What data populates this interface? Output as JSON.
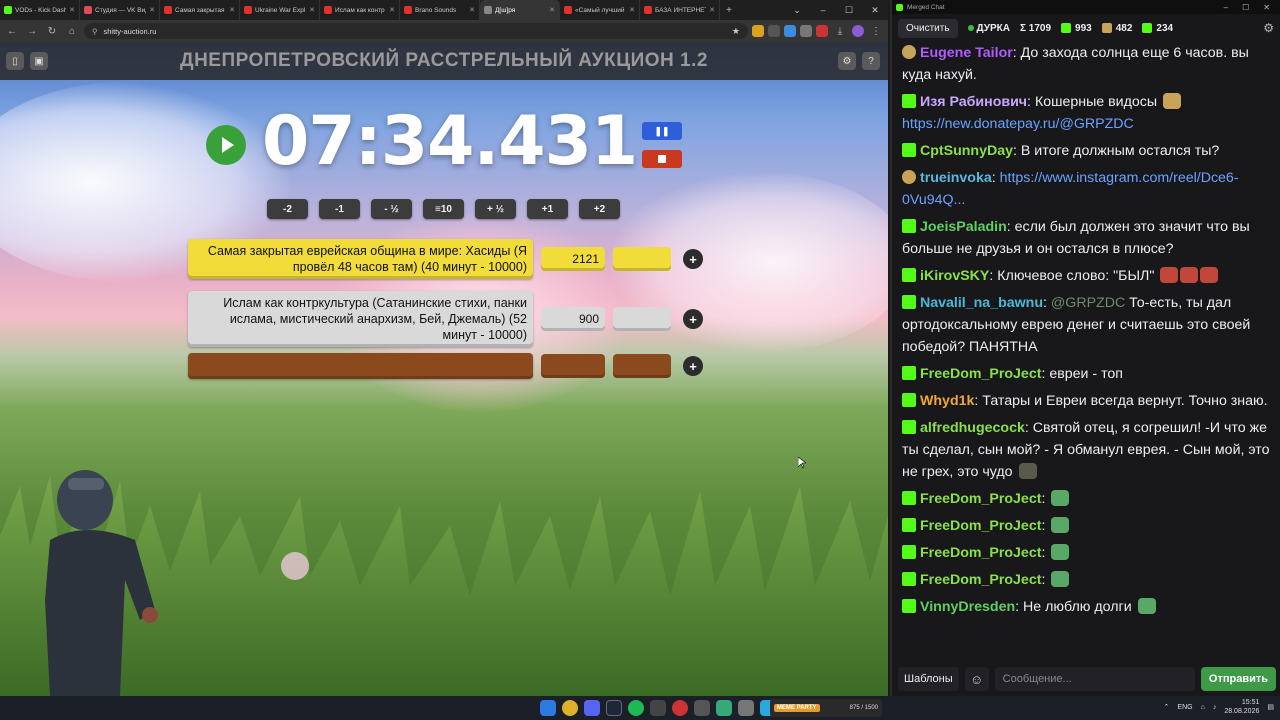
{
  "browser": {
    "tabs": [
      {
        "label": "VODs - Kick Dash",
        "color": "#53fc18",
        "active": false
      },
      {
        "label": "Студия — VK Вид",
        "color": "#e04a5b",
        "active": false
      },
      {
        "label": "Самая закрытая",
        "color": "#e03131",
        "active": false
      },
      {
        "label": "Ukraine War Expl",
        "color": "#e03131",
        "active": false
      },
      {
        "label": "Ислам как контр",
        "color": "#e03131",
        "active": false
      },
      {
        "label": "Brano Sounds",
        "color": "#e03131",
        "active": false
      },
      {
        "label": "Д[ш]ря",
        "color": "#888888",
        "active": true
      },
      {
        "label": "«Самый лучший",
        "color": "#e03131",
        "active": false
      },
      {
        "label": "БАЗА ИНТЕРНЕТ",
        "color": "#e03131",
        "active": false
      }
    ],
    "url": "shitty-auction.ru"
  },
  "app": {
    "title": "ДНЕПРОПЕТРОВСКИЙ РАССТРЕЛЬНЫЙ АУКЦИОН 1.2",
    "timer": "07:34.431",
    "pause_label": "❚❚",
    "adjust_buttons": [
      "-2",
      "-1",
      "- ½",
      "≡10",
      "+ ½",
      "+1",
      "+2"
    ],
    "lots": [
      {
        "name": "Самая закрытая еврейская община в мире: Хасиды (Я провёл 48 часов там) (40 минут - 10000)",
        "amount": "2121",
        "style": "yellow"
      },
      {
        "name": "Ислам как контркультура (Сатанинские стихи, панки ислама, мистический анархизм,  Бей, Джемаль) (52 минут - 10000)",
        "amount": "900",
        "style": "grey"
      },
      {
        "name": "",
        "amount": "",
        "style": "brown"
      }
    ],
    "add_label": "+"
  },
  "chat": {
    "window_title": "Merged Chat",
    "clear_label": "Очистить",
    "channel": "ДУРКА",
    "stat_total": "Σ 1709",
    "stat_kick": "993",
    "stat_other": "482",
    "stat_third": "234",
    "messages": [
      {
        "badge": "emote",
        "user": "Eugene Tailor",
        "color": "#b15cff",
        "parts": [
          {
            "t": "До захода солнца еще 6 часов. вы куда нахуй.",
            "k": "text"
          }
        ]
      },
      {
        "badge": "kick",
        "user": "Изя Рабинович",
        "color": "#c8a8ff",
        "parts": [
          {
            "t": "Кошерные видосы ",
            "k": "text"
          },
          {
            "t": "https://new.donatepay.ru/@GRPZDC",
            "k": "link"
          }
        ]
      },
      {
        "badge": "kick",
        "user": "CptSunnyDay",
        "color": "#8be04a",
        "parts": [
          {
            "t": "В итоге должным остался ты?",
            "k": "text"
          }
        ]
      },
      {
        "badge": "emote",
        "user": "trueinvoka",
        "color": "#5ab8e0",
        "parts": [
          {
            "t": "https://www.instagram.com/reel/Dce6-0Vu94Q...",
            "k": "link"
          }
        ]
      },
      {
        "badge": "kick",
        "user": "JoeisPaladin",
        "color": "#5fd05f",
        "parts": [
          {
            "t": "если был должен это значит что вы больше не друзья и он остался в плюсе?",
            "k": "text"
          }
        ]
      },
      {
        "badge": "kick",
        "user": "iKirovSKY",
        "color": "#8be04a",
        "parts": [
          {
            "t": "Ключевое слово: \"БЫЛ\"",
            "k": "text"
          }
        ]
      },
      {
        "badge": "kick",
        "user": "Navalil_na_bawnu",
        "color": "#4ab8d8",
        "parts": [
          {
            "t": "@GRPZDC",
            "k": "mention"
          },
          {
            "t": "  То-есть, ты дал ортодоксальному еврею денег и считаешь это своей победой? ПАНЯТНА",
            "k": "text"
          }
        ]
      },
      {
        "badge": "kick",
        "user": "FreeDom_ProJect",
        "color": "#8be04a",
        "parts": [
          {
            "t": "евреи - топ",
            "k": "text"
          }
        ]
      },
      {
        "badge": "kick",
        "user": "Whyd1k",
        "color": "#f0a830",
        "parts": [
          {
            "t": "Татары и Евреи всегда вернут. Точно знаю.",
            "k": "text"
          }
        ]
      },
      {
        "badge": "kick",
        "user": "alfredhugecock",
        "color": "#8be04a",
        "parts": [
          {
            "t": "Святой отец, я согрешил! -И что же ты сделал, сын мой? - Я обманул еврея. - Сын мой, это не грех, это чудо ",
            "k": "text"
          }
        ]
      },
      {
        "badge": "kick",
        "user": "FreeDom_ProJect",
        "color": "#8be04a",
        "parts": [
          {
            "t": "",
            "k": "text"
          }
        ]
      },
      {
        "badge": "kick",
        "user": "FreeDom_ProJect",
        "color": "#8be04a",
        "parts": [
          {
            "t": "",
            "k": "text"
          }
        ]
      },
      {
        "badge": "kick",
        "user": "FreeDom_ProJect",
        "color": "#8be04a",
        "parts": [
          {
            "t": "",
            "k": "text"
          }
        ]
      },
      {
        "badge": "kick",
        "user": "FreeDom_ProJect",
        "color": "#8be04a",
        "parts": [
          {
            "t": "",
            "k": "text"
          }
        ]
      },
      {
        "badge": "kick",
        "user": "VinnyDresden",
        "color": "#5fd05f",
        "parts": [
          {
            "t": "Не люблю долги",
            "k": "text"
          }
        ]
      }
    ],
    "templates_label": "Шаблоны",
    "input_placeholder": "Сообщение...",
    "send_label": "Отправить"
  },
  "taskbar": {
    "game_logo": "MEME PARTY",
    "game_counter": "875 / 1500",
    "lang": "ENG",
    "time": "15:51",
    "date": "28.08.2026"
  }
}
